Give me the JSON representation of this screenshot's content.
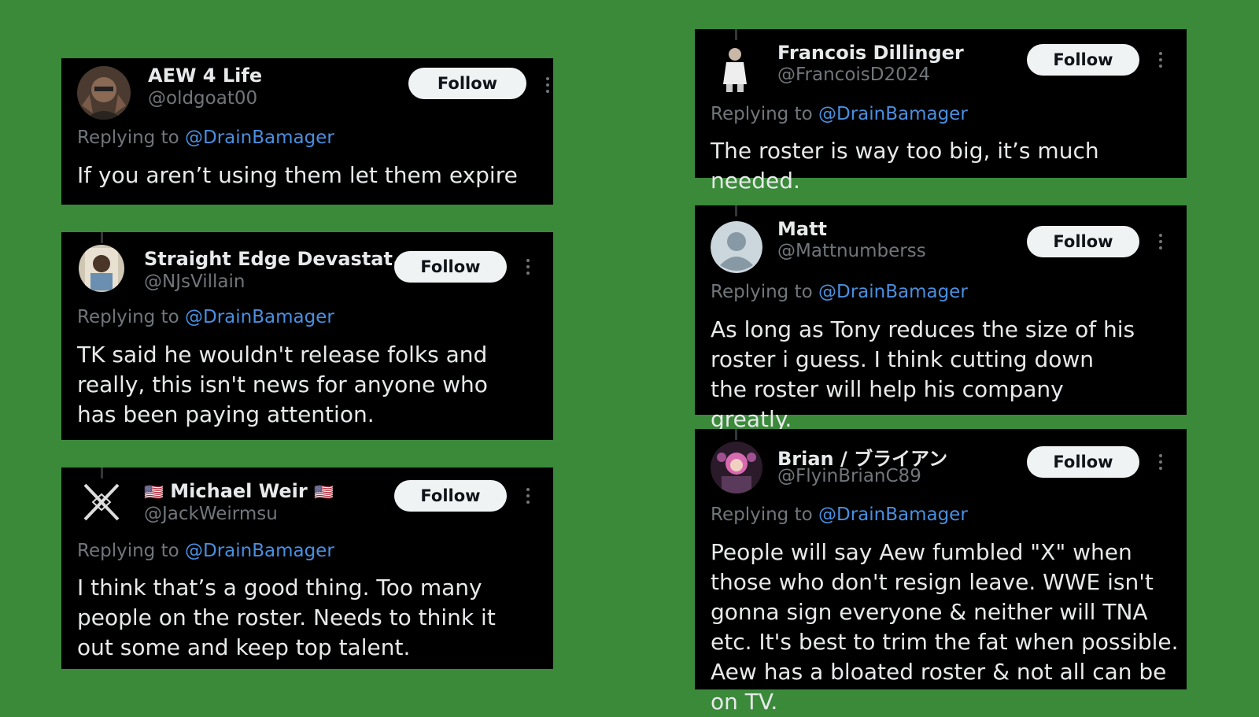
{
  "colors": {
    "background": "#3a8a3a",
    "card": "#000000",
    "mention": "#4a8fe0",
    "muted": "#71767b"
  },
  "replying_prefix": "Replying to",
  "replied_user": "@DrainBamager",
  "follow_label": "Follow",
  "tweets": [
    {
      "name": "AEW 4 Life",
      "handle": "@oldgoat00",
      "text": "If you aren’t using them let them expire"
    },
    {
      "name": "Straight Edge Devastat...",
      "handle": "@NJsVillain",
      "text": "TK said he wouldn't release folks and really, this isn't news for anyone who has been paying attention."
    },
    {
      "name": "Michael Weir",
      "name_flag": "🇺🇸",
      "handle": "@JackWeirmsu",
      "text": "I think that’s a good thing. Too many people on the roster. Needs to think it out some and keep top talent."
    },
    {
      "name": "Francois Dillinger",
      "handle": "@FrancoisD2024",
      "text": "The roster is way too big, it’s much needed."
    },
    {
      "name": "Matt",
      "handle": "@Mattnumberss",
      "text": "As long as Tony reduces the size of his roster i guess. I think cutting down the roster will help his company greatly."
    },
    {
      "name": "Brian / ブライアン",
      "handle": "@FlyinBrianC89",
      "text": "People will say Aew fumbled \"X\" when those who don't resign leave.  WWE isn't gonna sign everyone & neither will TNA etc. It's best to trim the fat when possible.  Aew has a bloated roster & not all can be on TV."
    }
  ]
}
